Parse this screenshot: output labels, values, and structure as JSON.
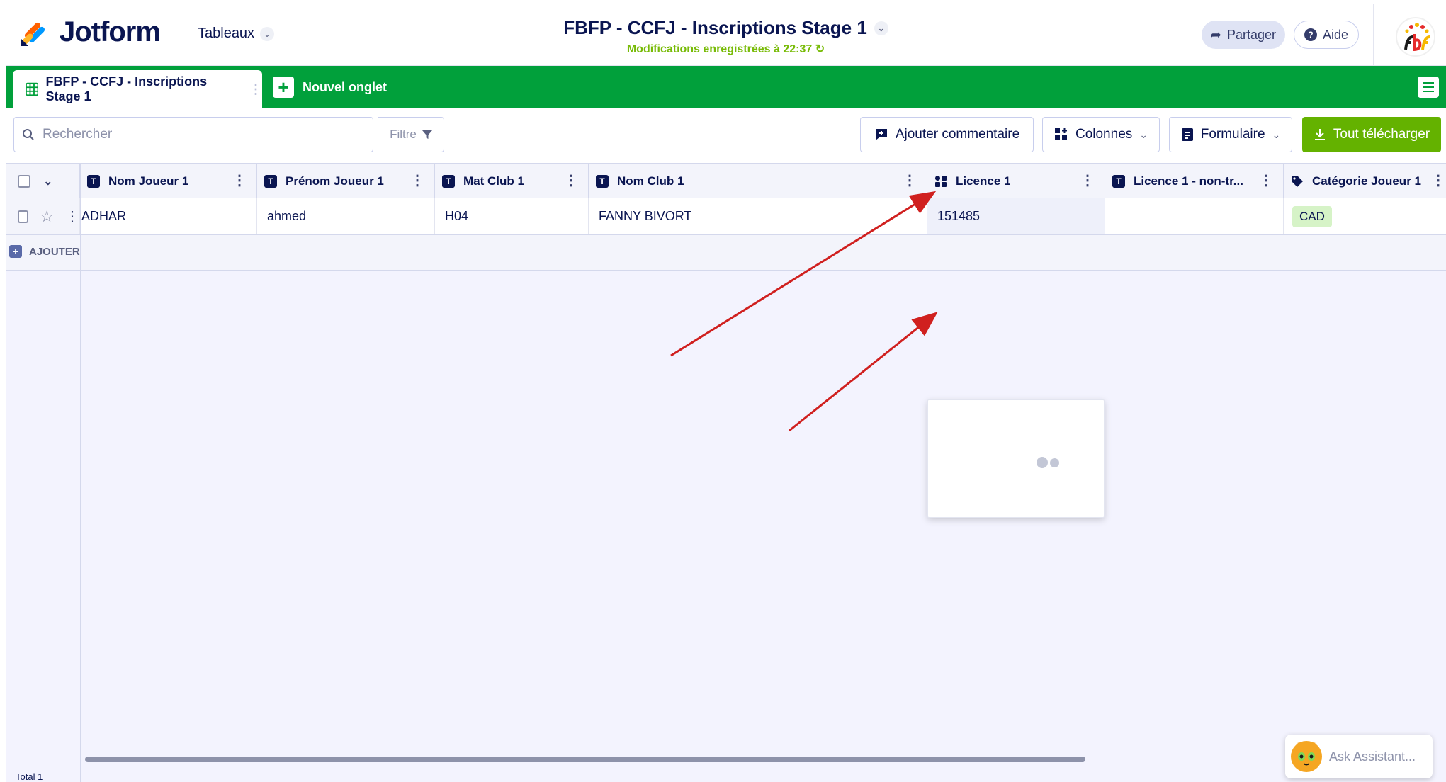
{
  "header": {
    "brand": "Jotform",
    "tables_menu": "Tableaux",
    "title": "FBFP - CCFJ - Inscriptions Stage 1",
    "saved_status": "Modifications enregistrées à 22:37",
    "share_label": "Partager",
    "help_label": "Aide",
    "help_symbol": "?"
  },
  "tabs": {
    "active_tab": "FBFP - CCFJ - Inscriptions Stage 1",
    "new_tab": "Nouvel onglet"
  },
  "toolbar": {
    "search_placeholder": "Rechercher",
    "filter_label": "Filtre",
    "add_comment_label": "Ajouter commentaire",
    "columns_label": "Colonnes",
    "form_label": "Formulaire",
    "download_label": "Tout télécharger"
  },
  "table": {
    "columns": [
      {
        "label": "Nom Joueur 1",
        "icon": "text-type-icon"
      },
      {
        "label": "Prénom Joueur 1",
        "icon": "text-type-icon"
      },
      {
        "label": "Mat Club 1",
        "icon": "text-type-icon"
      },
      {
        "label": "Nom Club 1",
        "icon": "text-type-icon"
      },
      {
        "label": "Licence 1",
        "icon": "widget-type-icon"
      },
      {
        "label": "Licence 1 - non-tr...",
        "icon": "text-type-icon"
      },
      {
        "label": "Catégorie Joueur 1",
        "icon": "tag-type-icon"
      }
    ],
    "rows": [
      {
        "nom": "ADHAR",
        "prenom": "ahmed",
        "mat_club": "H04",
        "nom_club": "FANNY BIVORT",
        "licence": "151485",
        "licence_non_tr": "",
        "categorie": "CAD"
      }
    ],
    "add_row_label": "AJOUTER",
    "type_letter": "T"
  },
  "footer": {
    "total_label": "Total 1"
  },
  "assistant": {
    "label": "Ask Assistant..."
  },
  "colors": {
    "accent_green": "#01a03b",
    "download_green": "#64b200",
    "navy": "#0a1551",
    "annotation_red": "#d0201f"
  }
}
